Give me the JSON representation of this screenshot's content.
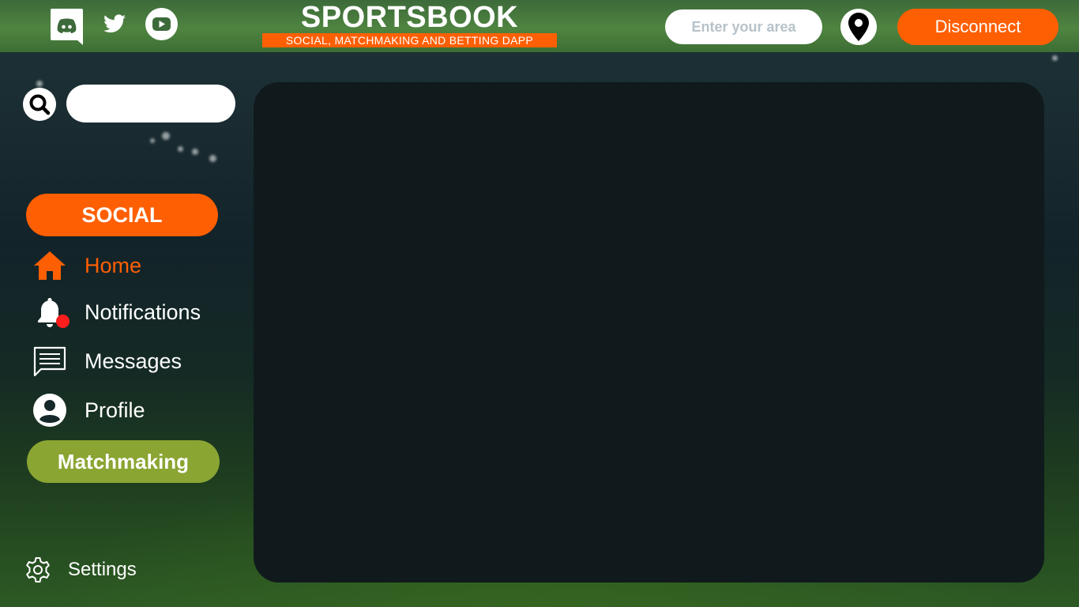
{
  "header": {
    "brand_title": "SPORTSBOOK",
    "brand_subtitle": "SOCIAL, MATCHMAKING AND BETTING DAPP",
    "social_links": [
      "discord-icon",
      "twitter-icon",
      "youtube-icon"
    ],
    "area_input": {
      "placeholder": "Enter your area",
      "value": ""
    },
    "location_icon": "map-pin-icon",
    "disconnect_label": "Disconnect"
  },
  "sidebar": {
    "search": {
      "placeholder": "",
      "value": ""
    },
    "social_section_label": "SOCIAL",
    "items": [
      {
        "label": "Home",
        "icon": "home-icon",
        "active": true
      },
      {
        "label": "Notifications",
        "icon": "bell-icon",
        "badge": "red-dot"
      },
      {
        "label": "Messages",
        "icon": "message-icon"
      },
      {
        "label": "Profile",
        "icon": "user-icon"
      }
    ],
    "matchmaking_section_label": "Matchmaking",
    "settings_label": "Settings"
  },
  "colors": {
    "accent_orange": "#ff5f03",
    "matchmaking_green": "#8aa532",
    "panel_dark": "#101a1c",
    "notification_red": "#ff1d1d"
  }
}
